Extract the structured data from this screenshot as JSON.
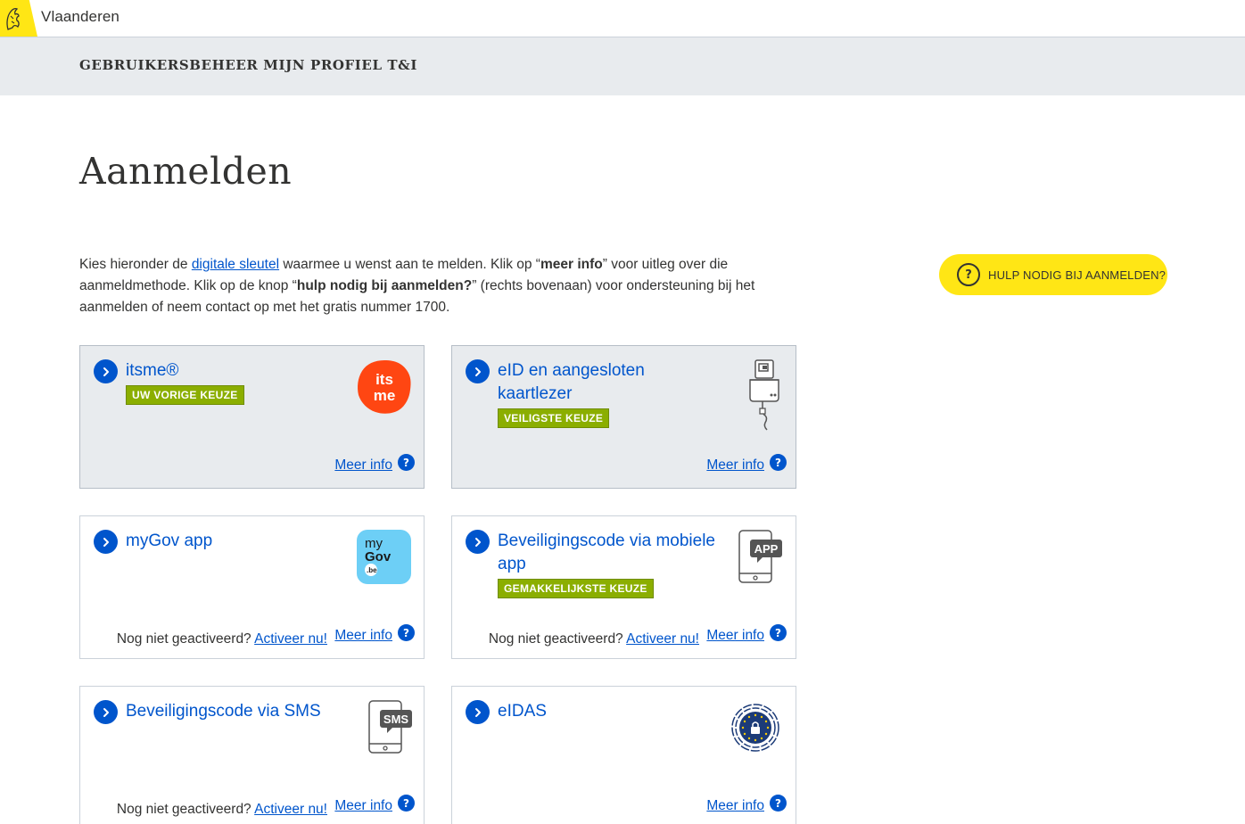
{
  "brand": {
    "name": "Vlaanderen"
  },
  "app": {
    "title": "GEBRUIKERSBEHEER MIJN PROFIEL T&I"
  },
  "page": {
    "title": "Aanmelden"
  },
  "intro": {
    "part1": "Kies hieronder de ",
    "link": "digitale sleutel",
    "part2": " waarmee u wenst aan te melden. Klik op “",
    "bold1": "meer info",
    "part3": "” voor uitleg over die aanmeldmethode. Klik op de knop “",
    "bold2": "hulp nodig bij aanmelden?",
    "part4": "” (rechts bovenaan) voor ondersteuning bij het aanmelden of neem contact op met het gratis nummer 1700."
  },
  "help_button": {
    "icon": "question-circle-icon",
    "label": "HULP NODIG BIJ AANMELDEN?"
  },
  "common": {
    "meer_info": "Meer info",
    "help_icon": "?",
    "not_activated": "Nog niet geactiveerd?",
    "activate_link": "Activeer nu!"
  },
  "methods": [
    {
      "title": "itsme®",
      "badge": "UW VORIGE KEUZE",
      "icon": "itsme-logo-icon",
      "icon_text_1": "its",
      "icon_text_2": "me",
      "icon_color": "#ff4612",
      "selected": true
    },
    {
      "title": "eID en aangesloten kaartlezer",
      "badge": "VEILIGSTE KEUZE",
      "icon": "card-reader-icon",
      "selected": true
    },
    {
      "title": "myGov app",
      "icon": "mygov-logo-icon",
      "icon_text_1": "my",
      "icon_text_2": "Gov",
      "icon_text_3": ".be",
      "icon_color": "#6dcff6",
      "selected": false
    },
    {
      "title": "Beveiligingscode via mobiele app",
      "badge": "GEMAKKELIJKSTE KEUZE",
      "icon": "phone-app-icon",
      "icon_label": "APP",
      "selected": false
    },
    {
      "title": "Beveiligingscode via SMS",
      "icon": "phone-sms-icon",
      "icon_label": "SMS",
      "selected": false
    },
    {
      "title": "eIDAS",
      "icon": "eidas-logo-icon",
      "selected": false
    }
  ],
  "colors": {
    "accent": "#0055cc",
    "badge": "#8bae00",
    "flanders_yellow": "#ffe615",
    "header_grey": "#e8ebee"
  }
}
